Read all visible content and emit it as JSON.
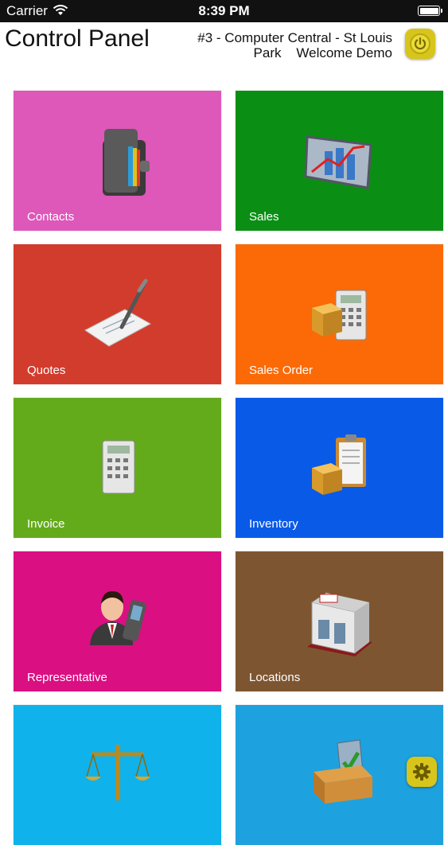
{
  "status_bar": {
    "carrier": "Carrier",
    "time": "8:39 PM"
  },
  "header": {
    "title": "Control Panel",
    "store_line1": "#3 - Computer Central - St Louis",
    "store_line2": "Park    Welcome Demo"
  },
  "tiles": [
    {
      "label": "Contacts",
      "color": "#dd58b9",
      "icon": "wallet-icon"
    },
    {
      "label": "Sales",
      "color": "#0a8f14",
      "icon": "sales-chart-icon"
    },
    {
      "label": "Quotes",
      "color": "#d23c2c",
      "icon": "pen-document-icon"
    },
    {
      "label": "Sales Order",
      "color": "#fb6a06",
      "icon": "box-calculator-icon"
    },
    {
      "label": "Invoice",
      "color": "#64ab1c",
      "icon": "calculator-icon"
    },
    {
      "label": "Inventory",
      "color": "#0a5ae8",
      "icon": "box-clipboard-icon"
    },
    {
      "label": "Representative",
      "color": "#da0f82",
      "icon": "person-phone-icon"
    },
    {
      "label": "Locations",
      "color": "#7d5631",
      "icon": "storefront-icon"
    },
    {
      "label": "",
      "color": "#10b2eb",
      "icon": "scales-icon"
    },
    {
      "label": "",
      "color": "#1ea1df",
      "icon": "inbox-icon"
    }
  ]
}
